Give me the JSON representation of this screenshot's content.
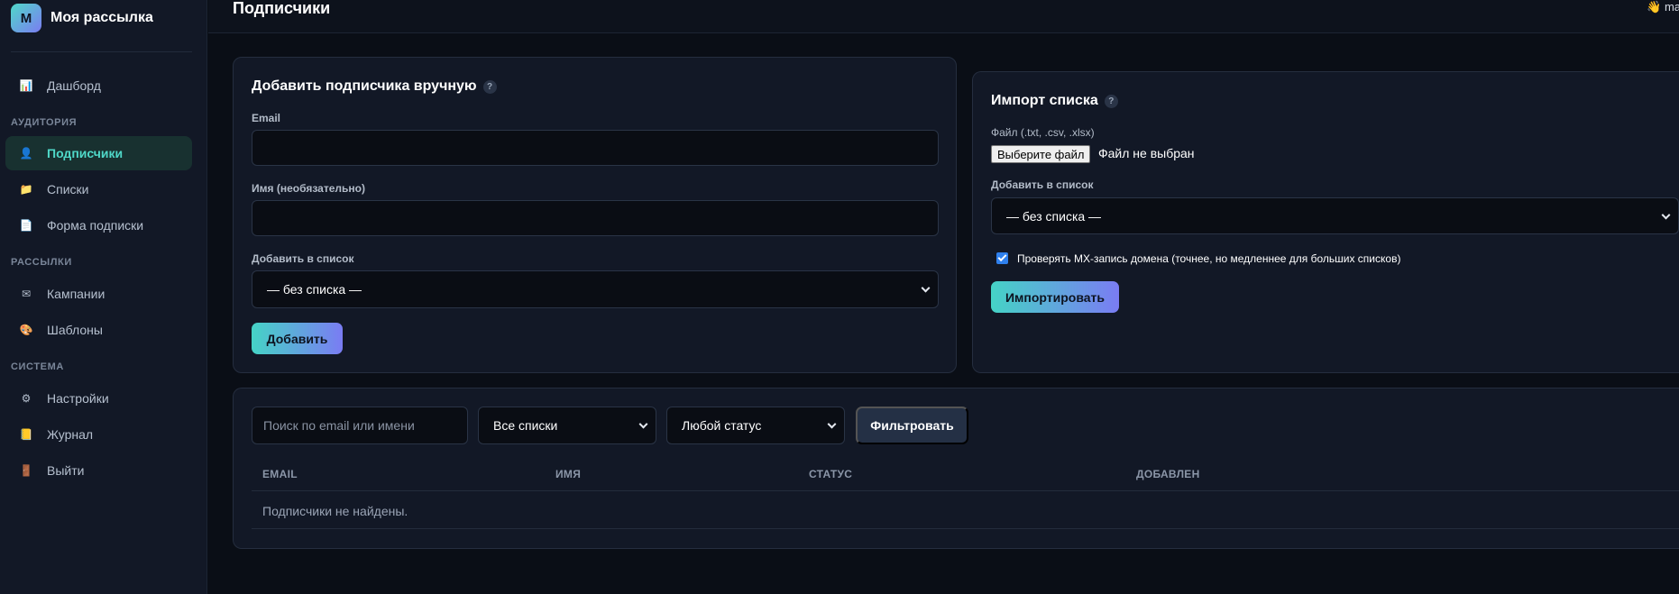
{
  "app": {
    "logo_letter": "M",
    "name": "Моя рассылка"
  },
  "sidebar": {
    "dashboard": {
      "label": "Дашборд",
      "icon": "chart-icon"
    },
    "sections": {
      "audience": "Аудитория",
      "mailings": "Рассылки",
      "system": "Система"
    },
    "items": {
      "subscribers": {
        "label": "Подписчики",
        "icon": "user-icon",
        "active": true
      },
      "lists": {
        "label": "Списки",
        "icon": "folder-icon"
      },
      "signup_form": {
        "label": "Форма подписки",
        "icon": "document-icon"
      },
      "campaigns": {
        "label": "Кампании",
        "icon": "envelope-icon"
      },
      "templates": {
        "label": "Шаблоны",
        "icon": "palette-icon"
      },
      "settings": {
        "label": "Настройки",
        "icon": "gear-icon"
      },
      "log": {
        "label": "Журнал",
        "icon": "journal-icon"
      },
      "logout": {
        "label": "Выйти",
        "icon": "door-icon"
      }
    }
  },
  "header": {
    "title": "Подписчики",
    "user_text": "👋 ma"
  },
  "add_manual": {
    "title": "Добавить подписчика вручную",
    "help": "?",
    "email_label": "Email",
    "email_value": "",
    "name_label": "Имя (необязательно)",
    "name_value": "",
    "list_label": "Добавить в список",
    "list_selected": "— без списка —",
    "submit_label": "Добавить"
  },
  "import": {
    "title": "Импорт списка",
    "help": "?",
    "file_label": "Файл (.txt, .csv, .xlsx)",
    "file_button": "Выберите файл",
    "file_status": "Файл не выбран",
    "list_label": "Добавить в список",
    "list_selected": "— без списка —",
    "mx_check_label": "Проверять MX-запись домена (точнее, но медленнее для больших списков)",
    "mx_check_checked": true,
    "submit_label": "Импортировать"
  },
  "filters": {
    "search_placeholder": "Поиск по email или имени",
    "search_value": "",
    "lists_selected": "Все списки",
    "status_selected": "Любой статус",
    "filter_button": "Фильтровать"
  },
  "table": {
    "columns": [
      "EMAIL",
      "ИМЯ",
      "СТАТУС",
      "ДОБАВЛЕН"
    ],
    "empty_message": "Подписчики не найдены."
  },
  "colors": {
    "accent_teal": "#4fd8c8",
    "accent_violet": "#7a7cf3",
    "background": "#0a0e16",
    "card": "#121826"
  }
}
